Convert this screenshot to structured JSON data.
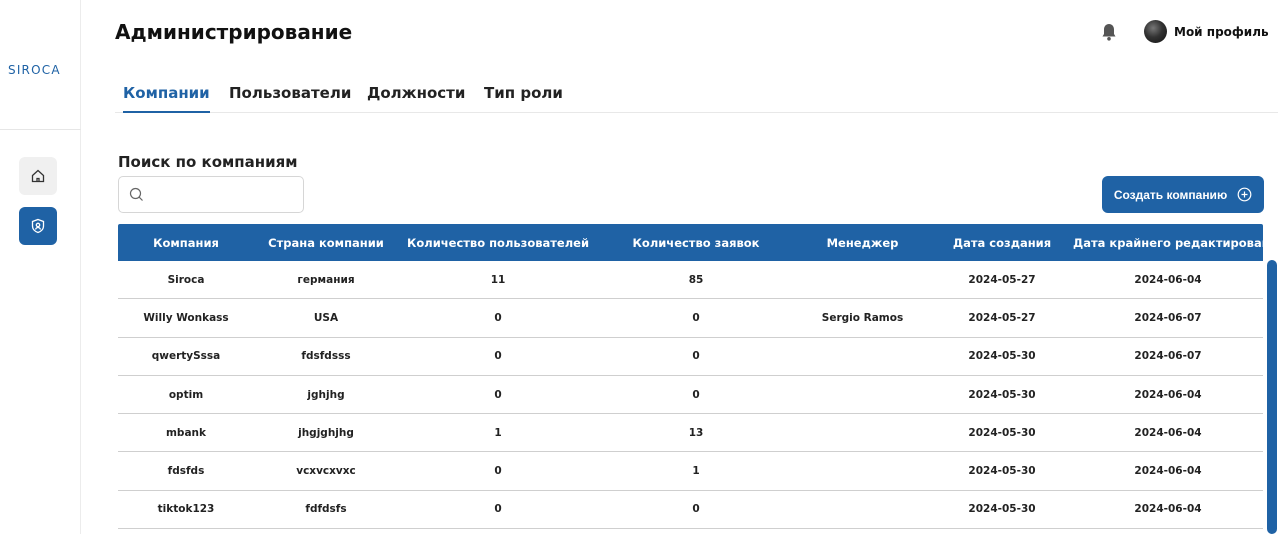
{
  "app": {
    "logo": "SIROCA"
  },
  "sidebar": {
    "items": [
      {
        "icon": "home-icon"
      },
      {
        "icon": "admin-badge-icon"
      }
    ]
  },
  "header": {
    "title": "Администрирование",
    "profile_label": "Мой профиль"
  },
  "tabs": [
    {
      "label": "Компании",
      "active": true
    },
    {
      "label": "Пользователи",
      "active": false
    },
    {
      "label": "Должности",
      "active": false
    },
    {
      "label": "Тип роли",
      "active": false
    }
  ],
  "search": {
    "label": "Поиск по компаниям",
    "placeholder": "",
    "value": ""
  },
  "create_button": {
    "label": "Создать компанию"
  },
  "table": {
    "headers": [
      "Компания",
      "Страна компании",
      "Количество пользователей",
      "Количество заявок",
      "Менеджер",
      "Дата создания",
      "Дата крайнего редактирования"
    ],
    "rows": [
      [
        "Siroca",
        "германия",
        "11",
        "85",
        "",
        "2024-05-27",
        "2024-06-04"
      ],
      [
        "Willy Wonkass",
        "USA",
        "0",
        "0",
        "Sergio Ramos",
        "2024-05-27",
        "2024-06-07"
      ],
      [
        "qwertySssa",
        "fdsfdsss",
        "0",
        "0",
        "",
        "2024-05-30",
        "2024-06-07"
      ],
      [
        "optim",
        "jghjhg",
        "0",
        "0",
        "",
        "2024-05-30",
        "2024-06-04"
      ],
      [
        "mbank",
        "jhgjghjhg",
        "1",
        "13",
        "",
        "2024-05-30",
        "2024-06-04"
      ],
      [
        "fdsfds",
        "vcxvcxvxc",
        "0",
        "1",
        "",
        "2024-05-30",
        "2024-06-04"
      ],
      [
        "tiktok123",
        "fdfdsfs",
        "0",
        "0",
        "",
        "2024-05-30",
        "2024-06-04"
      ]
    ]
  },
  "colors": {
    "accent": "#1f62a5"
  }
}
